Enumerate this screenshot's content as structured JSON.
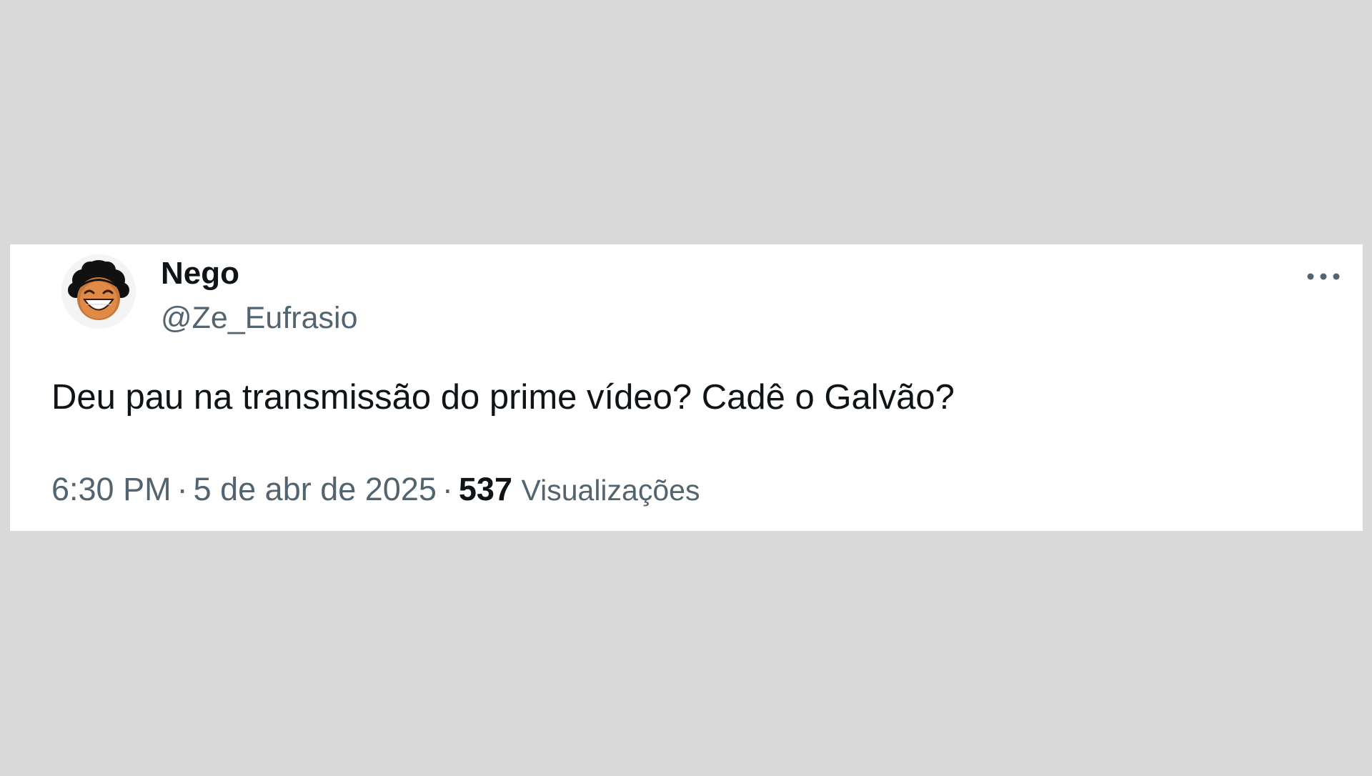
{
  "tweet": {
    "display_name": "Nego",
    "handle": "@Ze_Eufrasio",
    "text": "Deu pau na transmissão do prime vídeo? Cadê o Galvão?",
    "time": "6:30 PM",
    "separator": "·",
    "date": "5 de abr de 2025",
    "views_count": "537",
    "views_label": "Visualizações"
  },
  "icons": {
    "avatar": "smiling-face-avatar-icon",
    "more": "more-horizontal-icon"
  },
  "colors": {
    "background": "#d9d9d9",
    "card": "#ffffff",
    "primary_text": "#0f1419",
    "secondary_text": "#536471"
  }
}
